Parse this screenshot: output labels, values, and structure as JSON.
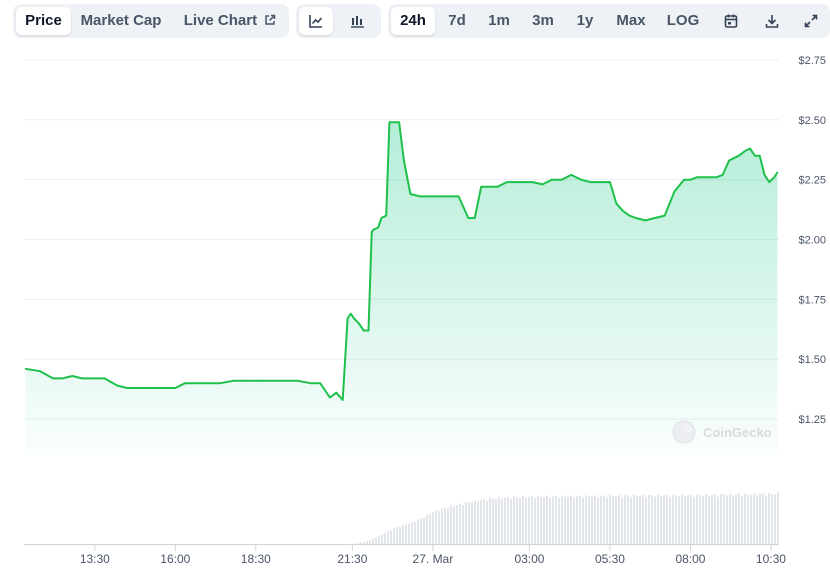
{
  "toolbar": {
    "metric_tabs": [
      {
        "label": "Price",
        "active": true
      },
      {
        "label": "Market Cap",
        "active": false
      },
      {
        "label": "Live Chart",
        "active": false,
        "icon": "external-link-icon"
      }
    ],
    "chart_style_icons": [
      "line-chart-icon",
      "candlestick-chart-icon"
    ],
    "range_tabs": [
      {
        "label": "24h",
        "active": true
      },
      {
        "label": "7d",
        "active": false
      },
      {
        "label": "1m",
        "active": false
      },
      {
        "label": "3m",
        "active": false
      },
      {
        "label": "1y",
        "active": false
      },
      {
        "label": "Max",
        "active": false
      },
      {
        "label": "LOG",
        "active": false
      }
    ],
    "action_icons": [
      "calendar-icon",
      "download-icon",
      "expand-icon"
    ]
  },
  "watermark": "CoinGecko",
  "colors": {
    "line": "#1ec14b",
    "fill": "#16c784",
    "volume": "#e2e5e9",
    "grid": "#eceff3",
    "toolbar_bg": "#eef2f6"
  },
  "chart_data": {
    "type": "area",
    "title": "",
    "xlabel": "",
    "ylabel": "",
    "ylim": [
      1.1,
      2.85
    ],
    "y_ticks": [
      1.25,
      1.5,
      1.75,
      2.0,
      2.25,
      2.5,
      2.75
    ],
    "y_tick_labels": [
      "$1.25",
      "$1.50",
      "$1.75",
      "$2.00",
      "$2.25",
      "$2.50",
      "$2.75"
    ],
    "x_ticks": [
      13.5,
      16.0,
      18.5,
      21.5,
      24.0,
      27.0,
      29.5,
      32.0,
      34.5
    ],
    "x_tick_labels": [
      "13:30",
      "16:00",
      "18:30",
      "21:30",
      "27. Mar",
      "03:00",
      "05:30",
      "08:00",
      "10:30"
    ],
    "xlim": [
      11.3,
      34.75
    ],
    "grid": true,
    "legend": "none",
    "series": [
      {
        "x": [
          11.35,
          11.8,
          12.2,
          12.5,
          12.8,
          13.1,
          13.4,
          13.8,
          14.2,
          14.5,
          14.9,
          15.3,
          15.7,
          16.0,
          16.3,
          16.6,
          17.0,
          17.4,
          17.8,
          18.2,
          18.6,
          19.0,
          19.4,
          19.8,
          20.2,
          20.5,
          20.8,
          21.0,
          21.2,
          21.35,
          21.45,
          21.55,
          21.7,
          21.85,
          22.0,
          22.1,
          22.15,
          22.3,
          22.4,
          22.55,
          22.65,
          22.7,
          22.95,
          23.1,
          23.3,
          23.6,
          23.9,
          24.2,
          24.5,
          24.8,
          25.1,
          25.3,
          25.5,
          25.7,
          26.0,
          26.3,
          26.6,
          26.9,
          27.1,
          27.4,
          27.7,
          28.0,
          28.3,
          28.6,
          28.9,
          29.2,
          29.5,
          29.7,
          29.9,
          30.1,
          30.3,
          30.6,
          30.9,
          31.2,
          31.5,
          31.8,
          32.0,
          32.2,
          32.4,
          32.6,
          32.8,
          33.0,
          33.2,
          33.5,
          33.7,
          33.85,
          34.0,
          34.15,
          34.3,
          34.45,
          34.6,
          34.7
        ],
        "y": [
          1.46,
          1.45,
          1.42,
          1.42,
          1.43,
          1.42,
          1.42,
          1.42,
          1.39,
          1.38,
          1.38,
          1.38,
          1.38,
          1.38,
          1.4,
          1.4,
          1.4,
          1.4,
          1.41,
          1.41,
          1.41,
          1.41,
          1.41,
          1.41,
          1.4,
          1.4,
          1.34,
          1.36,
          1.33,
          1.67,
          1.69,
          1.67,
          1.65,
          1.62,
          1.62,
          2.03,
          2.04,
          2.05,
          2.09,
          2.1,
          2.49,
          2.49,
          2.49,
          2.33,
          2.19,
          2.18,
          2.18,
          2.18,
          2.18,
          2.18,
          2.09,
          2.09,
          2.22,
          2.22,
          2.22,
          2.24,
          2.24,
          2.24,
          2.24,
          2.23,
          2.25,
          2.25,
          2.27,
          2.25,
          2.24,
          2.24,
          2.24,
          2.15,
          2.12,
          2.1,
          2.09,
          2.08,
          2.09,
          2.1,
          2.2,
          2.25,
          2.25,
          2.26,
          2.26,
          2.26,
          2.26,
          2.27,
          2.33,
          2.35,
          2.37,
          2.38,
          2.35,
          2.35,
          2.27,
          2.24,
          2.26,
          2.28
        ]
      }
    ],
    "volume": {
      "x": [
        11.35,
        21.5,
        21.9,
        22.2,
        22.5,
        22.8,
        23.1,
        23.5,
        23.9,
        24.3,
        24.8,
        25.2,
        25.8,
        26.5,
        28.0,
        30.0,
        32.0,
        34.7
      ],
      "level": [
        0.0,
        0.0,
        0.05,
        0.12,
        0.22,
        0.3,
        0.36,
        0.45,
        0.58,
        0.68,
        0.75,
        0.8,
        0.86,
        0.88,
        0.9,
        0.91,
        0.92,
        0.95
      ]
    }
  }
}
